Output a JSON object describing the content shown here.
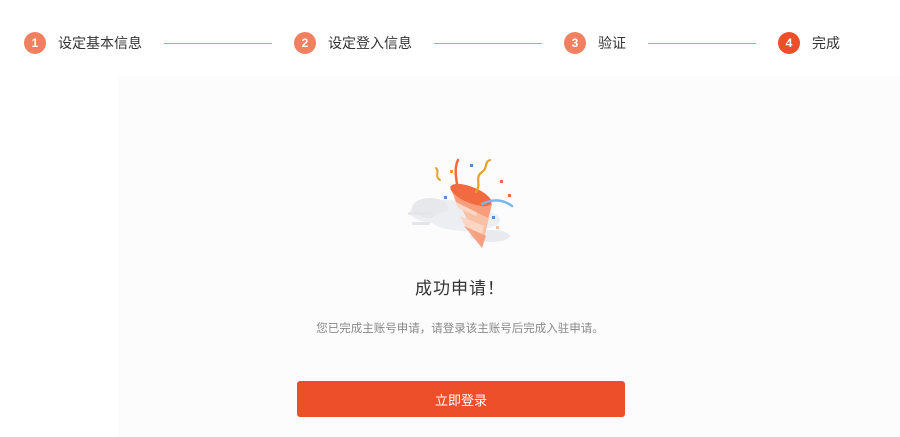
{
  "steps": [
    {
      "num": "1",
      "label": "设定基本信息"
    },
    {
      "num": "2",
      "label": "设定登入信息"
    },
    {
      "num": "3",
      "label": "验证"
    },
    {
      "num": "4",
      "label": "完成"
    }
  ],
  "result": {
    "title": "成功申请！",
    "description": "您已完成主账号申请，请登录该主账号后完成入驻申请。",
    "button_label": "立即登录"
  },
  "colors": {
    "accent": "#ee4f2b",
    "step_done": "#f08060",
    "connector": "#e39a82"
  },
  "icons": {
    "illustration": "party-popper-icon"
  }
}
